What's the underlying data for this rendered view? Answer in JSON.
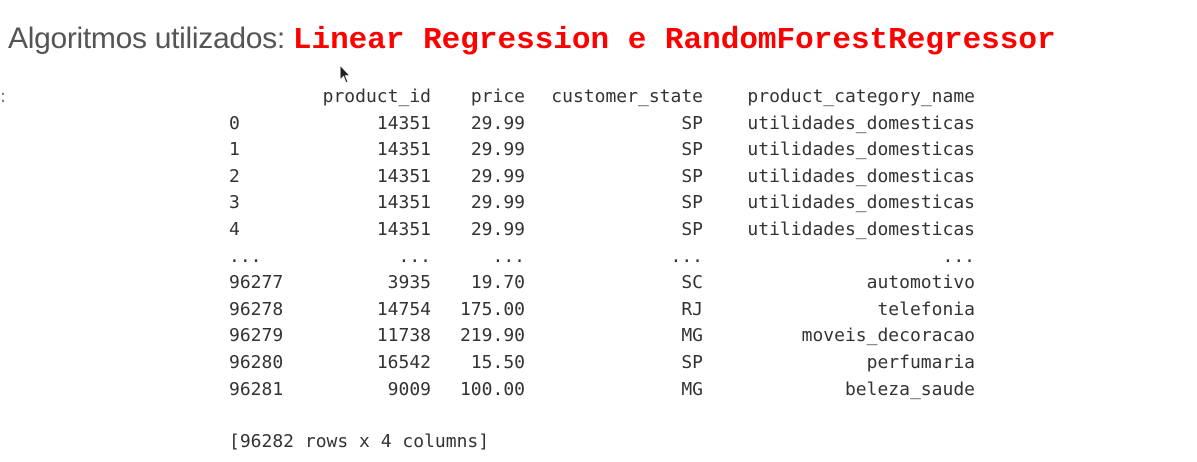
{
  "heading": {
    "label": "Algoritmos utilizados:",
    "algorithms": "Linear Regression e RandomForestRegressor"
  },
  "left_marker": ":",
  "cursor_icon": "mouse-pointer-icon",
  "dataframe": {
    "columns": [
      "",
      "product_id",
      "price",
      "customer_state",
      "product_category_name"
    ],
    "rows": [
      [
        "0",
        "14351",
        "29.99",
        "SP",
        "utilidades_domesticas"
      ],
      [
        "1",
        "14351",
        "29.99",
        "SP",
        "utilidades_domesticas"
      ],
      [
        "2",
        "14351",
        "29.99",
        "SP",
        "utilidades_domesticas"
      ],
      [
        "3",
        "14351",
        "29.99",
        "SP",
        "utilidades_domesticas"
      ],
      [
        "4",
        "14351",
        "29.99",
        "SP",
        "utilidades_domesticas"
      ],
      [
        "...",
        "...",
        "...",
        "...",
        "..."
      ],
      [
        "96277",
        "3935",
        "19.70",
        "SC",
        "automotivo"
      ],
      [
        "96278",
        "14754",
        "175.00",
        "RJ",
        "telefonia"
      ],
      [
        "96279",
        "11738",
        "219.90",
        "MG",
        "moveis_decoracao"
      ],
      [
        "96280",
        "16542",
        "15.50",
        "SP",
        "perfumaria"
      ],
      [
        "96281",
        "9009",
        "100.00",
        "MG",
        "beleza_saude"
      ]
    ],
    "summary": "[96282 rows x 4 columns]"
  },
  "colors": {
    "accent": "#ff0000",
    "heading_text": "#555555",
    "output_text": "#333333"
  }
}
